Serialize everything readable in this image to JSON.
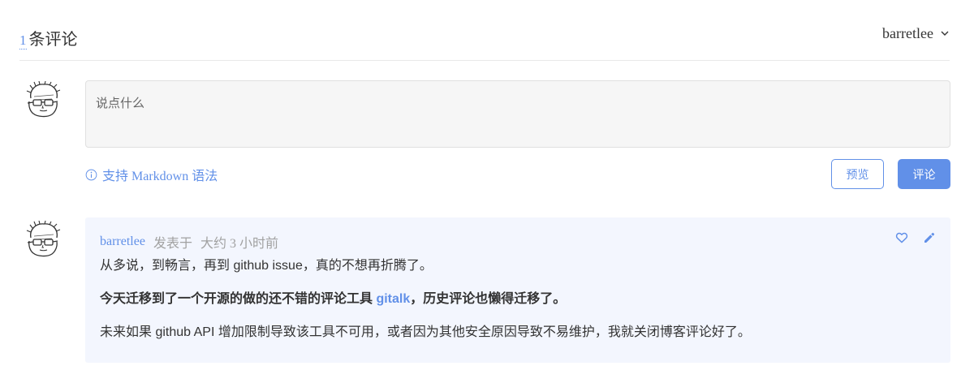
{
  "header": {
    "count": "1",
    "count_suffix": "条评论",
    "username": "barretlee"
  },
  "editor": {
    "placeholder": "说点什么",
    "value": ""
  },
  "markdown_tip": "支持 Markdown 语法",
  "buttons": {
    "preview": "预览",
    "submit": "评论"
  },
  "comment": {
    "author": "barretlee",
    "posted_label": "发表于",
    "time": "大约 3 小时前",
    "p1": "从多说，到畅言，再到 github issue，真的不想再折腾了。",
    "p2_before": "今天迁移到了一个开源的做的还不错的评论工具 ",
    "p2_link": "gitalk",
    "p2_after": "，历史评论也懒得迁移了。",
    "p3": "未来如果 github API 增加限制导致该工具不可用，或者因为其他安全原因导致不易维护，我就关闭博客评论好了。"
  },
  "icons": {
    "user_avatar": "avatar",
    "dropdown": "chevron-down-icon",
    "info": "info-icon",
    "like": "heart-icon",
    "edit": "pencil-icon"
  },
  "colors": {
    "accent": "#6190e8",
    "comment_bg": "#f3f6fe"
  }
}
